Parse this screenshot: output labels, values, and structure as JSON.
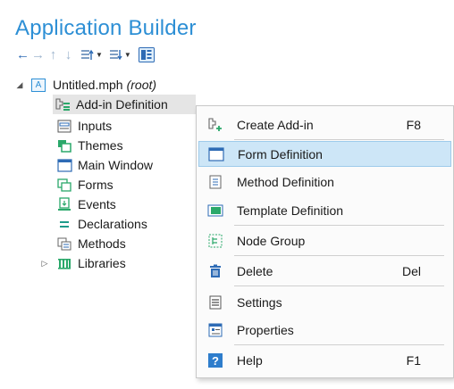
{
  "panel": {
    "title": "Application Builder"
  },
  "toolbar": {
    "buttons": [
      {
        "icon": "arrow-left-icon",
        "glyph": "←",
        "enabled": true
      },
      {
        "icon": "arrow-right-icon",
        "glyph": "→",
        "enabled": false
      },
      {
        "icon": "arrow-up-icon",
        "glyph": "↑",
        "enabled": false
      },
      {
        "icon": "arrow-down-icon",
        "glyph": "↓",
        "enabled": false
      }
    ]
  },
  "tree": {
    "root": {
      "label": "Untitled.mph",
      "tag": "(root)",
      "icon_letter": "A"
    },
    "items": [
      {
        "label": "Add-in Definition",
        "icon": "add-in-definition-icon"
      },
      {
        "label": "Inputs",
        "icon": "inputs-icon"
      },
      {
        "label": "Themes",
        "icon": "themes-icon"
      },
      {
        "label": "Main Window",
        "icon": "main-window-icon"
      },
      {
        "label": "Forms",
        "icon": "forms-icon"
      },
      {
        "label": "Events",
        "icon": "events-icon"
      },
      {
        "label": "Declarations",
        "icon": "declarations-icon"
      },
      {
        "label": "Methods",
        "icon": "methods-icon"
      },
      {
        "label": "Libraries",
        "icon": "libraries-icon"
      }
    ]
  },
  "context_menu": {
    "items": [
      {
        "label": "Create Add-in",
        "shortcut": "F8",
        "icon": "create-add-in-icon"
      },
      {
        "label": "Form Definition",
        "shortcut": "",
        "icon": "form-definition-icon",
        "highlighted": true
      },
      {
        "label": "Method Definition",
        "shortcut": "",
        "icon": "method-definition-icon"
      },
      {
        "label": "Template Definition",
        "shortcut": "",
        "icon": "template-definition-icon"
      },
      {
        "label": "Node Group",
        "shortcut": "",
        "icon": "node-group-icon"
      },
      {
        "label": "Delete",
        "shortcut": "Del",
        "icon": "delete-icon"
      },
      {
        "label": "Settings",
        "shortcut": "",
        "icon": "settings-icon"
      },
      {
        "label": "Properties",
        "shortcut": "",
        "icon": "properties-icon"
      },
      {
        "label": "Help",
        "shortcut": "F1",
        "icon": "help-icon"
      }
    ]
  },
  "colors": {
    "accent": "#2d8fd5",
    "menu_highlight": "#cde6f7",
    "selected_row": "#e5e5e5"
  }
}
